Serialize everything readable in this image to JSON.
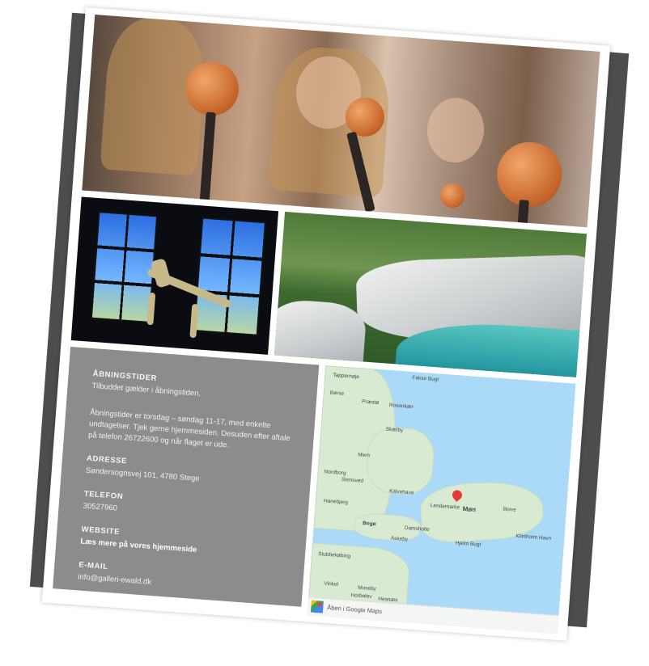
{
  "info": {
    "opening_heading": "Åbningstider",
    "opening_line1": "Tilbuddet gælder i åbningstiden.",
    "opening_line2": "Åbningstider er torsdag – søndag 11-17, med enkelte undtagelser. Tjek gerne hjemmesiden. Desuden efter aftale på telefon 26722600 og når flaget er ude.",
    "address_heading": "ADRESSE",
    "address_value": "Søndersognsvej 101, 4780 Stege",
    "phone_heading": "TELEFON",
    "phone_value": "30527960",
    "website_heading": "WEBSITE",
    "website_link": "Læs mere på vores hjemmeside",
    "email_heading": "E-MAIL",
    "email_value": "info@galleri-ewald.dk"
  },
  "map": {
    "open_in_maps": "Åben i Google Maps",
    "labels": {
      "tappernoje": "Tappernøje",
      "borse": "Børse",
      "praesto": "Præstø",
      "rosenkaer": "Rosenkær",
      "stensved": "Stensved",
      "mern": "Mern",
      "bogo": "Bogø",
      "kalvehave": "Kalvehave",
      "lendemarke": "Lendemarke",
      "mon": "Møn",
      "borre": "Borre",
      "klintholm": "Klintholm Havn",
      "damsholte": "Damsholte",
      "stubbekobing": "Stubbekøbing",
      "vinkel": "Vinkel",
      "horbelev": "Horbelev",
      "hesnaes": "Hesnæs",
      "moseby": "Moseby",
      "hjelm": "Hjelm Bugt",
      "fakse": "Fakse Bugt",
      "askeby": "Askeby",
      "skaelby": "Skælby",
      "hanebjerg": "Hanebjerg",
      "nordborg": "Nordborg"
    }
  },
  "colors": {
    "backdrop": "#4d4d4d",
    "info_panel": "#8c8c8c",
    "map_water": "#aadaf8",
    "map_land": "#d9ead2",
    "pin": "#e53935"
  }
}
